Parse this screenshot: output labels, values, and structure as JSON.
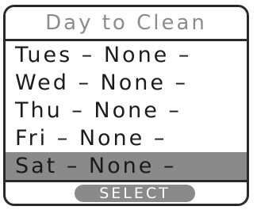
{
  "header": {
    "title": "Day to Clean"
  },
  "list": {
    "items": [
      {
        "label": "Tues – None –"
      },
      {
        "label": "Wed – None –"
      },
      {
        "label": "Thu – None –"
      },
      {
        "label": "Fri – None –"
      },
      {
        "label": "Sat – None –"
      }
    ],
    "selected_label": "Sat – None –"
  },
  "footer": {
    "select_label": "SELECT"
  },
  "colors": {
    "frame": "#2a2a2a",
    "title_text": "#8c8c8c",
    "highlight": "#8a8a8a",
    "button_text": "#ffffff"
  }
}
